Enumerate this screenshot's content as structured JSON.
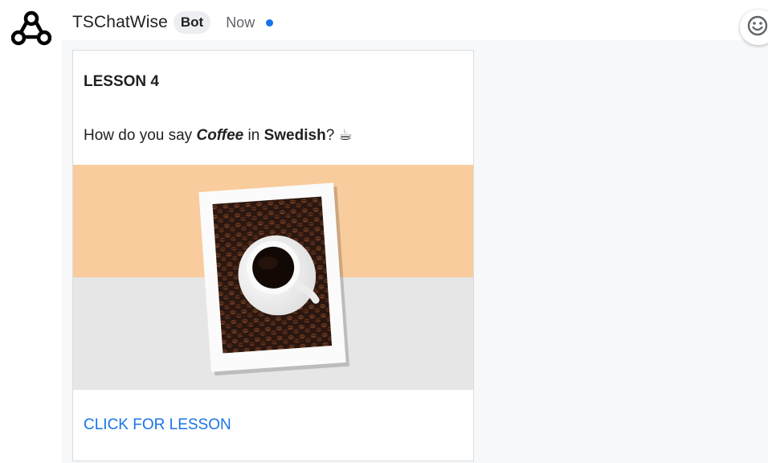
{
  "sender": {
    "name": "TSChatWise",
    "badge": "Bot",
    "time": "Now"
  },
  "icons": {
    "avatar": "webhook-icon",
    "emoji": "emoji-smile-icon",
    "coffee_emoji": "☕"
  },
  "colors": {
    "link": "#1a73e8",
    "unread_dot": "#1a73e8",
    "image_top": "#f8cc9c",
    "image_bottom": "#e6e6e6"
  },
  "card": {
    "title": "LESSON 4",
    "text": {
      "prefix": "How do you say ",
      "word": "Coffee",
      "middle": " in ",
      "language": "Swedish",
      "suffix": "? "
    },
    "image_description_icon": "coffee-polaroid-image",
    "link": "CLICK FOR LESSON"
  }
}
